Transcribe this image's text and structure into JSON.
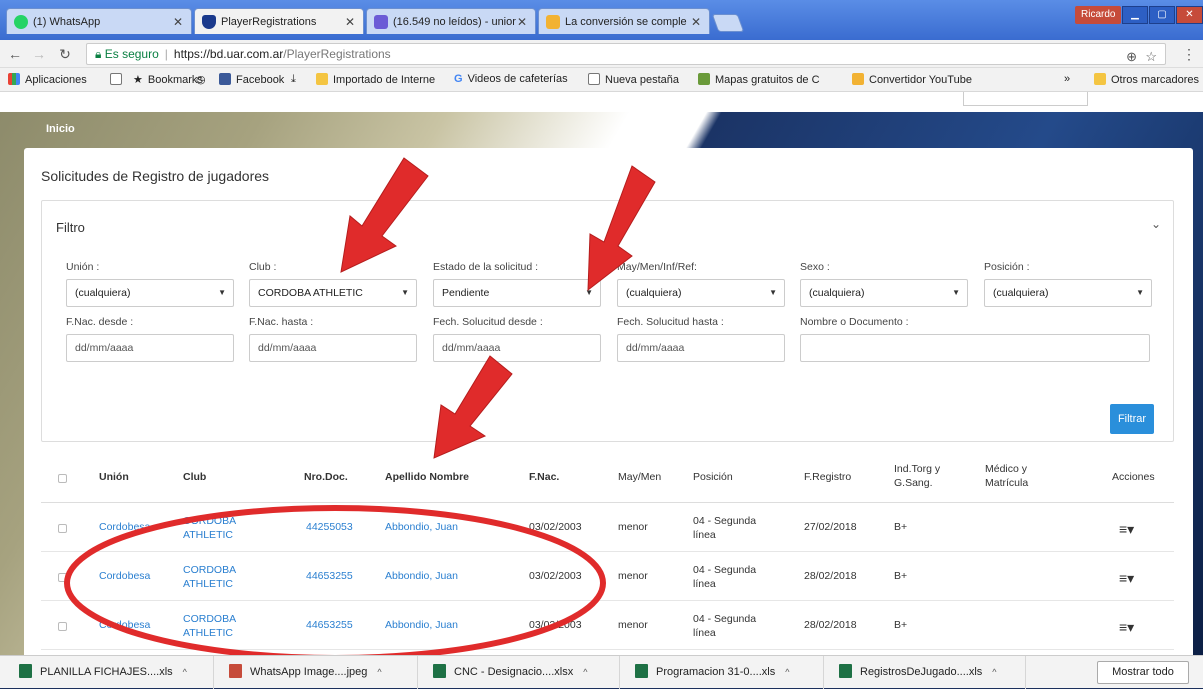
{
  "browser": {
    "tabs": [
      {
        "label": "(1) WhatsApp",
        "icon": "whatsapp-icon",
        "color": "#25d366"
      },
      {
        "label": "PlayerRegistrations",
        "icon": "uar-shield-icon",
        "color": "#1b3a8c"
      },
      {
        "label": "(16.549 no leídos) - unior",
        "icon": "mail-icon",
        "color": "#6b5bd6"
      },
      {
        "label": "La conversión se comple",
        "icon": "convert-icon",
        "color": "#f2b233"
      }
    ],
    "user": "Ricardo",
    "address": {
      "secure_label": "Es seguro",
      "host": "https://bd.uar.com.ar",
      "path": "/PlayerRegistrations"
    },
    "bookmarks": [
      {
        "label": "Aplicaciones",
        "icon": "apps-icon"
      },
      {
        "label": "",
        "icon": "page-icon"
      },
      {
        "label": "Bookmarks",
        "icon": "star-icon"
      },
      {
        "label": "",
        "icon": "history-icon"
      },
      {
        "label": "Facebook",
        "icon": "facebook-icon"
      },
      {
        "label": "",
        "icon": "download-icon"
      },
      {
        "label": "Importado de Interne",
        "icon": "folder-icon"
      },
      {
        "label": "Videos de cafeterías",
        "icon": "google-icon"
      },
      {
        "label": "Nueva pestaña",
        "icon": "page-icon"
      },
      {
        "label": "Mapas gratuitos de C",
        "icon": "map-icon"
      },
      {
        "label": "Convertidor YouTube",
        "icon": "convert-icon"
      }
    ],
    "bookmarks_more": "»",
    "other_bookmarks": "Otros marcadores"
  },
  "page": {
    "breadcrumb": "Inicio",
    "title": "Solicitudes de Registro de jugadores",
    "filter": {
      "title": "Filtro",
      "selects": [
        {
          "label": "Unión :",
          "value": "(cualquiera)"
        },
        {
          "label": "Club :",
          "value": "CORDOBA ATHLETIC"
        },
        {
          "label": "Estado de la solicitud :",
          "value": "Pendiente"
        },
        {
          "label": "May/Men/Inf/Ref:",
          "value": "(cualquiera)"
        },
        {
          "label": "Sexo :",
          "value": "(cualquiera)"
        },
        {
          "label": "Posición :",
          "value": "(cualquiera)"
        }
      ],
      "inputs": [
        {
          "label": "F.Nac. desde :",
          "placeholder": "dd/mm/aaaa"
        },
        {
          "label": "F.Nac. hasta :",
          "placeholder": "dd/mm/aaaa"
        },
        {
          "label": "Fech. Solucitud desde :",
          "placeholder": "dd/mm/aaaa"
        },
        {
          "label": "Fech. Solucitud hasta :",
          "placeholder": "dd/mm/aaaa"
        },
        {
          "label": "Nombre o Documento :",
          "placeholder": ""
        }
      ],
      "button": "Filtrar"
    },
    "table": {
      "headers": [
        "Unión",
        "Club",
        "Nro.Doc.",
        "Apellido Nombre",
        "F.Nac.",
        "May/Men",
        "Posición",
        "F.Registro",
        "Ind.Torg y G.Sang.",
        "Médico y Matrícula",
        "Acciones"
      ],
      "rows": [
        {
          "union": "Cordobesa",
          "club": "CORDOBA ATHLETIC",
          "doc": "44255053",
          "name": "Abbondio, Juan",
          "birth": "03/02/2003",
          "category": "menor",
          "position": "04 - Segunda línea",
          "registered": "27/02/2018",
          "blood": "B+"
        },
        {
          "union": "Cordobesa",
          "club": "CORDOBA ATHLETIC",
          "doc": "44653255",
          "name": "Abbondio, Juan",
          "birth": "03/02/2003",
          "category": "menor",
          "position": "04 - Segunda línea",
          "registered": "28/02/2018",
          "blood": "B+"
        },
        {
          "union": "Cordobesa",
          "club": "CORDOBA ATHLETIC",
          "doc": "44653255",
          "name": "Abbondio, Juan",
          "birth": "03/02/2003",
          "category": "menor",
          "position": "04 - Segunda línea",
          "registered": "28/02/2018",
          "blood": "B+"
        }
      ]
    }
  },
  "downloads": {
    "items": [
      {
        "label": "PLANILLA FICHAJES....xls",
        "icon": "excel-file-icon"
      },
      {
        "label": "WhatsApp Image....jpeg",
        "icon": "image-file-icon"
      },
      {
        "label": "CNC - Designacio....xlsx",
        "icon": "excel-file-icon"
      },
      {
        "label": "Programacion 31-0....xls",
        "icon": "excel-file-icon"
      },
      {
        "label": "RegistrosDeJugado....xls",
        "icon": "excel-file-icon"
      }
    ],
    "show_all": "Mostrar todo"
  },
  "colors": {
    "link": "#2a7fd0",
    "primary_button": "#2a8fdb",
    "annotation": "#e02b2b"
  }
}
